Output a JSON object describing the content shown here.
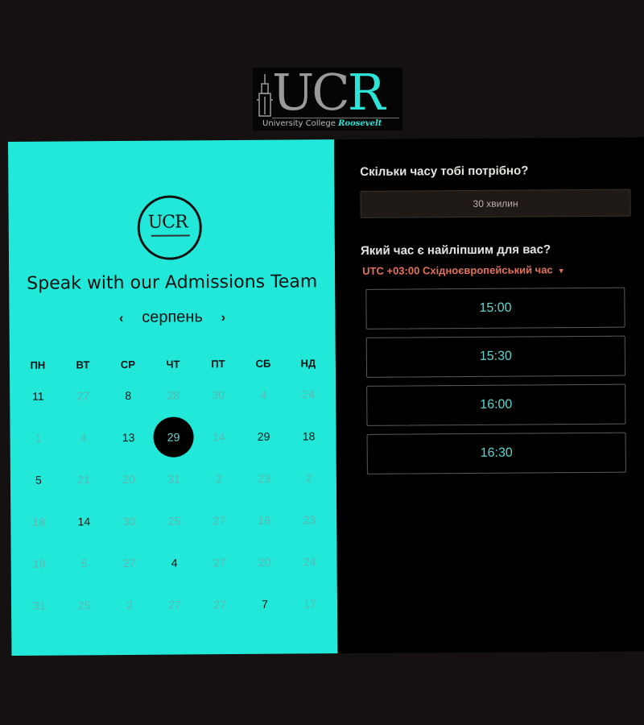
{
  "header": {
    "logo_u": "UC",
    "logo_r": "R",
    "logo_sub": "University College",
    "logo_sub_accent": "Roosevelt"
  },
  "left": {
    "badge_text": "UCR",
    "headline": "Speak with our Admissions Team",
    "month": "серпень",
    "prev_icon": "chevron-left-icon",
    "next_icon": "chevron-right-icon",
    "weekdays": [
      "ПН",
      "ВТ",
      "СР",
      "ЧТ",
      "ПТ",
      "СБ",
      "НД"
    ],
    "weeks": [
      [
        {
          "d": "11",
          "a": true
        },
        {
          "d": "27",
          "a": false
        },
        {
          "d": "8",
          "a": true
        },
        {
          "d": "28",
          "a": false
        },
        {
          "d": "30",
          "a": false
        },
        {
          "d": "4",
          "a": false
        },
        {
          "d": "24",
          "a": false
        }
      ],
      [
        {
          "d": "1",
          "a": false
        },
        {
          "d": "4",
          "a": false
        },
        {
          "d": "13",
          "a": true
        },
        {
          "d": "29",
          "a": true,
          "s": true
        },
        {
          "d": "14",
          "a": false
        },
        {
          "d": "29",
          "a": true
        },
        {
          "d": "18",
          "a": true
        }
      ],
      [
        {
          "d": "5",
          "a": true
        },
        {
          "d": "21",
          "a": false
        },
        {
          "d": "20",
          "a": false
        },
        {
          "d": "31",
          "a": false
        },
        {
          "d": "2",
          "a": false
        },
        {
          "d": "23",
          "a": false
        },
        {
          "d": "2",
          "a": false
        }
      ],
      [
        {
          "d": "18",
          "a": false
        },
        {
          "d": "14",
          "a": true
        },
        {
          "d": "30",
          "a": false
        },
        {
          "d": "25",
          "a": false
        },
        {
          "d": "27",
          "a": false
        },
        {
          "d": "16",
          "a": false
        },
        {
          "d": "23",
          "a": false
        }
      ],
      [
        {
          "d": "19",
          "a": false
        },
        {
          "d": "5",
          "a": false
        },
        {
          "d": "27",
          "a": false
        },
        {
          "d": "4",
          "a": true
        },
        {
          "d": "27",
          "a": false
        },
        {
          "d": "20",
          "a": false
        },
        {
          "d": "24",
          "a": false
        }
      ],
      [
        {
          "d": "31",
          "a": false
        },
        {
          "d": "25",
          "a": false
        },
        {
          "d": "2",
          "a": false
        },
        {
          "d": "27",
          "a": false
        },
        {
          "d": "27",
          "a": false
        },
        {
          "d": "7",
          "a": true
        },
        {
          "d": "17",
          "a": false
        }
      ]
    ]
  },
  "right": {
    "duration_question": "Скільки часу тобі потрібно?",
    "duration_value": "30 хвилин",
    "time_question": "Який час є найліпшим для вас?",
    "timezone": "UTC +03:00 Східноєвропейський час",
    "timezone_utc": "UTC +03:00",
    "timezone_name": "Східноєвропейський час",
    "slots": [
      "15:00",
      "15:30",
      "16:00",
      "16:30"
    ]
  },
  "colors": {
    "accent": "#22e8d9",
    "timezone": "#e2725b",
    "slot_text": "#5cd4cb"
  }
}
